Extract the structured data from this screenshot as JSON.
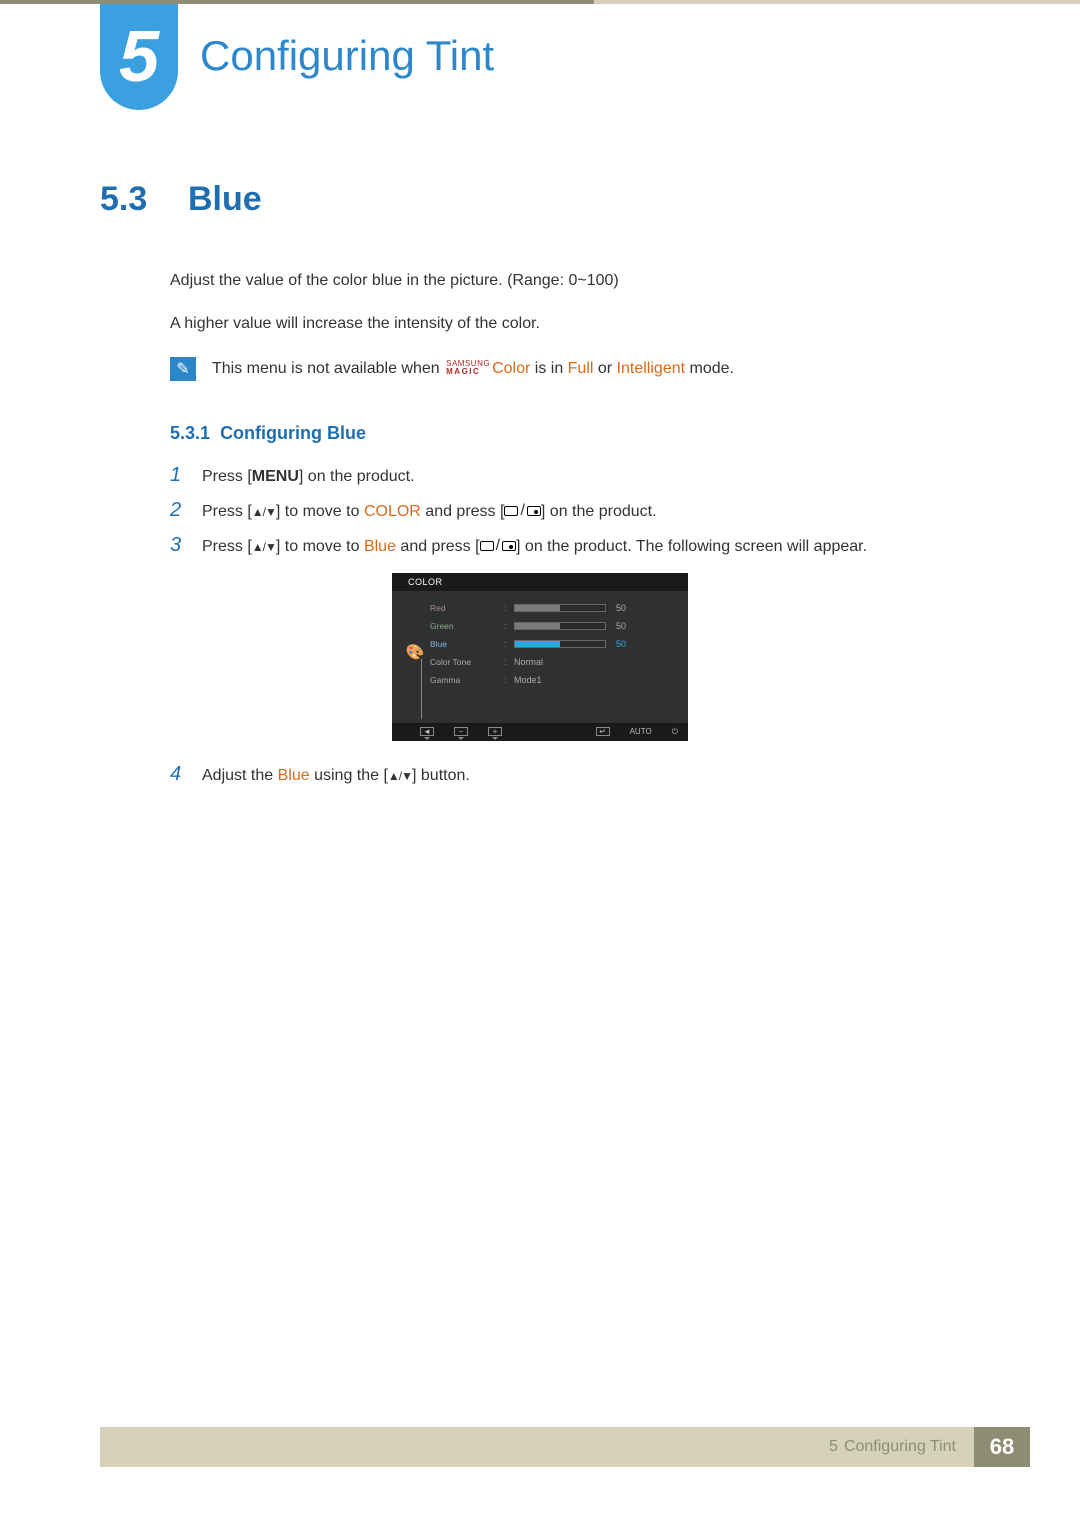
{
  "chapter": {
    "number": "5",
    "title": "Configuring Tint"
  },
  "section": {
    "number": "5.3",
    "title": "Blue",
    "desc1": "Adjust the value of the color blue in the picture. (Range: 0~100)",
    "desc2": "A higher value will increase the intensity of the color."
  },
  "note": {
    "prefix": "This menu is not available when ",
    "brand_top": "SAMSUNG",
    "brand_bottom": "MAGIC",
    "brand_suffix": "Color",
    "mid1": " is in ",
    "mode1": "Full",
    "mid2": " or ",
    "mode2": "Intelligent",
    "suffix": " mode."
  },
  "subsection": {
    "number": "5.3.1",
    "title": "Configuring Blue"
  },
  "steps": {
    "s1": {
      "num": "1",
      "a": "Press [",
      "b": "MENU",
      "c": "] on the product."
    },
    "s2": {
      "num": "2",
      "a": "Press [",
      "arrows": "▲/▼",
      "b": "] to move to ",
      "link": "COLOR",
      "c": " and press [",
      "d": "] on the product."
    },
    "s3": {
      "num": "3",
      "a": "Press [",
      "arrows": "▲/▼",
      "b": "] to move to ",
      "link": "Blue",
      "c": " and press [",
      "d": "] on the product. The following screen will appear."
    },
    "s4": {
      "num": "4",
      "a": "Adjust the ",
      "link": "Blue",
      "b": " using the [",
      "arrows": "▲/▼",
      "c": "] button."
    }
  },
  "osd": {
    "title": "COLOR",
    "rows": {
      "red": {
        "label": "Red",
        "value": "50",
        "fill": 50
      },
      "green": {
        "label": "Green",
        "value": "50",
        "fill": 50
      },
      "blue": {
        "label": "Blue",
        "value": "50",
        "fill": 50
      },
      "tone": {
        "label": "Color Tone",
        "text": "Normal"
      },
      "gamma": {
        "label": "Gamma",
        "text": "Mode1"
      }
    },
    "footer": {
      "back": "◄",
      "minus": "−",
      "plus": "+",
      "enter_icon": "↵",
      "auto": "AUTO",
      "power": "⏻"
    }
  },
  "footer": {
    "chapter_num": "5",
    "chapter_title": "Configuring Tint",
    "page": "68"
  }
}
